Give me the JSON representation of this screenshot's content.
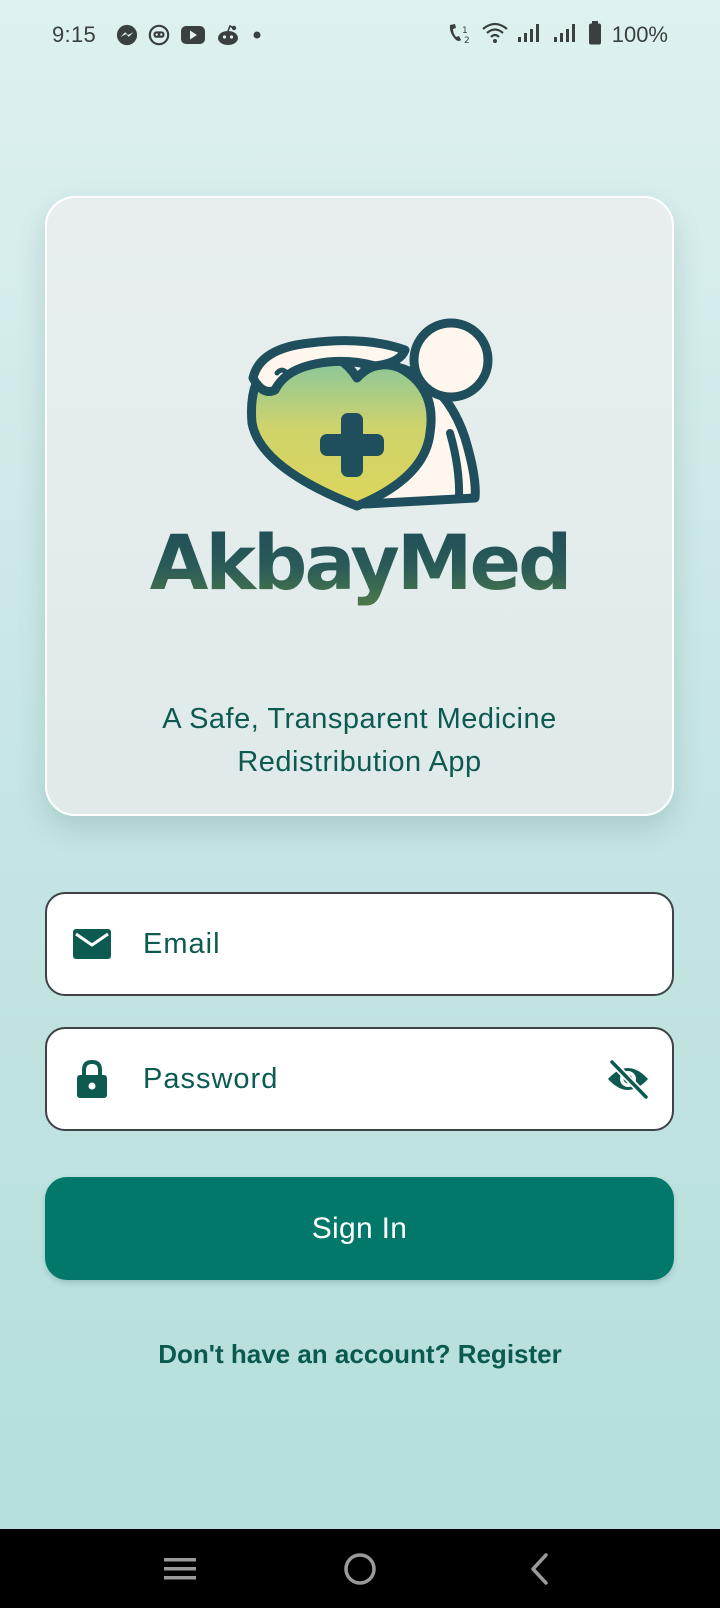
{
  "status_bar": {
    "time": "9:15",
    "left_icons": [
      "messenger-icon",
      "bot-icon",
      "youtube-icon",
      "reddit-icon",
      "dot-icon"
    ],
    "right_icons": [
      "wifi-calling-icon",
      "wifi-icon",
      "signal-icon",
      "signal-icon"
    ],
    "battery_percent": "100%"
  },
  "logo": {
    "brand_name": "AkbayMed",
    "tagline_line1": "A Safe, Transparent Medicine",
    "tagline_line2": "Redistribution App",
    "colors": {
      "outline": "#1f4f5c",
      "heart_top": "#7fc5a2",
      "heart_bottom": "#dcd65a",
      "figure": "#fff6ee"
    }
  },
  "form": {
    "email_placeholder": "Email",
    "email_value": "",
    "password_placeholder": "Password",
    "password_value": "",
    "sign_in_label": "Sign In",
    "register_text": "Don't have an account? Register"
  },
  "nav_bar": {
    "buttons": [
      "menu-icon",
      "home-icon",
      "back-icon"
    ]
  },
  "colors": {
    "primary": "#02786a",
    "text": "#0d5a50",
    "background_top": "#def1f0",
    "background_bottom": "#b3deda"
  }
}
